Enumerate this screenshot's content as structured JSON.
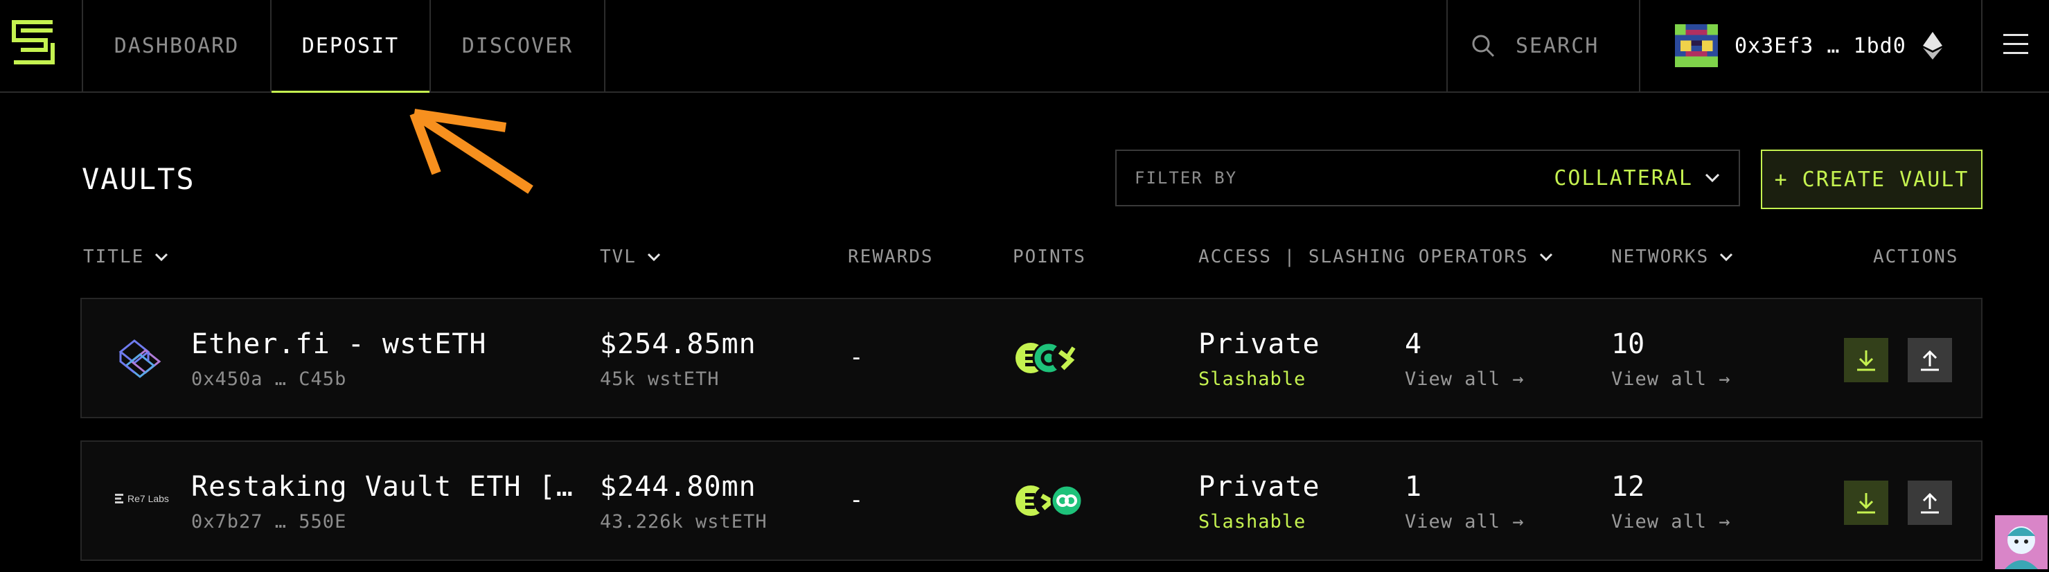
{
  "nav": {
    "tabs": [
      {
        "label": "DASHBOARD"
      },
      {
        "label": "DEPOSIT"
      },
      {
        "label": "DISCOVER"
      }
    ],
    "search_label": "SEARCH",
    "wallet_address": "0x3Ef3 … 1bd0",
    "network_icon": "ethereum-icon",
    "accent_color": "#c5f250"
  },
  "header": {
    "title": "VAULTS",
    "filter_label": "FILTER BY",
    "filter_value": "COLLATERAL",
    "create_button": "+ CREATE VAULT"
  },
  "columns": {
    "title": "TITLE",
    "tvl": "TVL",
    "rewards": "REWARDS",
    "points": "POINTS",
    "access": "ACCESS | SLASHING OPERATORS",
    "networks": "NETWORKS",
    "actions": "ACTIONS"
  },
  "rows": [
    {
      "name": "Ether.fi - wstETH",
      "address": "0x450a … C45b",
      "tvl": "$254.85mn",
      "tvl_sub": "45k wstETH",
      "rewards": "-",
      "access": "Private",
      "slashing": "Slashable",
      "operators": "4",
      "operators_link": "View all →",
      "networks": "10",
      "networks_link": "View all →"
    },
    {
      "name": "Restaking Vault ETH […",
      "address": "0x7b27 … 550E",
      "logo_text": "Re7 Labs",
      "tvl": "$244.80mn",
      "tvl_sub": "43.226k wstETH",
      "rewards": "-",
      "access": "Private",
      "slashing": "Slashable",
      "operators": "1",
      "operators_link": "View all →",
      "networks": "12",
      "networks_link": "View all →"
    }
  ]
}
